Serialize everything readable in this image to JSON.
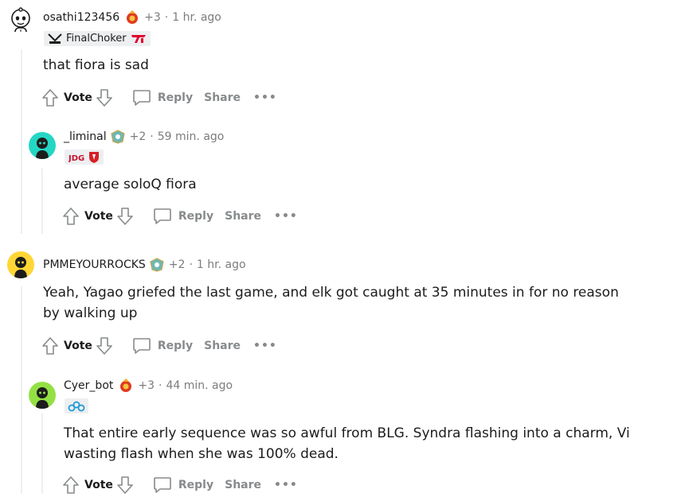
{
  "comments": [
    {
      "username": "osathi123456",
      "points": "+3",
      "time": "1 hr. ago",
      "flair_text": "FinalChoker",
      "body": "that fiora is sad",
      "vote_label": "Vote",
      "reply_label": "Reply",
      "share_label": "Share"
    },
    {
      "username": "_liminal",
      "points": "+2",
      "time": "59 min. ago",
      "body": "average soloQ fiora",
      "vote_label": "Vote",
      "reply_label": "Reply",
      "share_label": "Share"
    },
    {
      "username": "PMMEYOURROCKS",
      "points": "+2",
      "time": "1 hr. ago",
      "body": "Yeah, Yagao griefed the last game, and elk got caught at 35 minutes in for no reason by walking up",
      "vote_label": "Vote",
      "reply_label": "Reply",
      "share_label": "Share"
    },
    {
      "username": "Cyer_bot",
      "points": "+3",
      "time": "44 min. ago",
      "body": "That entire early sequence was so awful from BLG. Syndra flashing into a charm, Vi wasting flash when she was 100% dead.",
      "vote_label": "Vote",
      "reply_label": "Reply",
      "share_label": "Share"
    }
  ],
  "separator": "·",
  "more_label": "•••",
  "colors": {
    "text": "#1c1c1c",
    "meta": "#7c7c7c",
    "action": "#878a8c",
    "thread_line": "#edeff1",
    "flair_bg": "#edeff1"
  }
}
